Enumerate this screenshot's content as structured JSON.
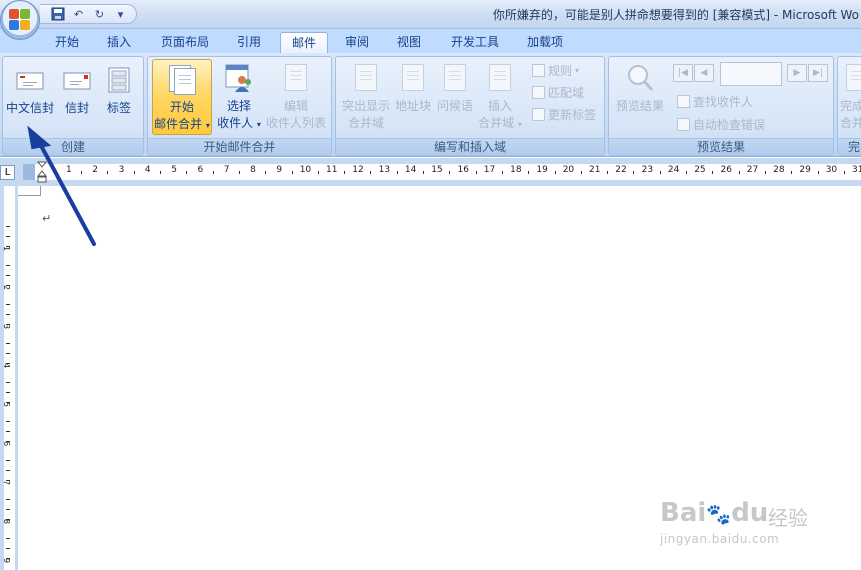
{
  "window": {
    "title": "你所嫌弃的，可能是别人拼命想要得到的 [兼容模式] - Microsoft Wo"
  },
  "quick_access": {
    "undo_glyph": "↶",
    "redo_glyph": "↻",
    "more_glyph": "▾"
  },
  "tabs": [
    {
      "label": "开始"
    },
    {
      "label": "插入"
    },
    {
      "label": "页面布局"
    },
    {
      "label": "引用"
    },
    {
      "label": "邮件"
    },
    {
      "label": "审阅"
    },
    {
      "label": "视图"
    },
    {
      "label": "开发工具"
    },
    {
      "label": "加载项"
    }
  ],
  "active_tab": "邮件",
  "ribbon": {
    "create": {
      "label": "创建",
      "chinese_envelope": "中文信封",
      "envelope": "信封",
      "labels": "标签"
    },
    "start_merge": {
      "label": "开始邮件合并",
      "start_line1": "开始",
      "start_line2": "邮件合并",
      "select_line1": "选择",
      "select_line2": "收件人",
      "edit_line1": "编辑",
      "edit_line2": "收件人列表"
    },
    "write_insert": {
      "label": "编写和插入域",
      "highlight_line1": "突出显示",
      "highlight_line2": "合并域",
      "address_block": "地址块",
      "greeting": "问候语",
      "insert_line1": "插入",
      "insert_line2": "合并域",
      "rules": "规则",
      "match_fields": "匹配域",
      "update_labels": "更新标签"
    },
    "preview": {
      "label": "预览结果",
      "preview_results": "预览结果",
      "find_recipient": "查找收件人",
      "auto_check": "自动检查错误"
    },
    "finish": {
      "label_partial": "完",
      "finish_line1": "完成",
      "finish_line2": "合并"
    }
  },
  "ruler": {
    "corner_glyph": "L",
    "ticks": [
      1,
      2,
      3,
      4,
      5,
      6,
      7,
      8,
      9,
      10,
      11,
      12,
      13,
      14,
      15,
      16,
      17,
      18,
      19,
      20,
      21,
      22,
      23,
      24,
      25,
      26,
      27,
      28,
      29,
      30,
      31
    ],
    "vticks": [
      1,
      2,
      3,
      4,
      5,
      6,
      7,
      8,
      9
    ]
  },
  "document": {
    "paragraph_mark": "↵"
  },
  "watermark": {
    "brand": "Bai",
    "brand2": "du",
    "cn": "经验",
    "url": "jingyan.baidu.com"
  },
  "colors": {
    "ribbon_bg": "#c6dbf4",
    "tab_text": "#15428b",
    "arrow": "#1a3e9e",
    "active_button": "#ffd865"
  }
}
